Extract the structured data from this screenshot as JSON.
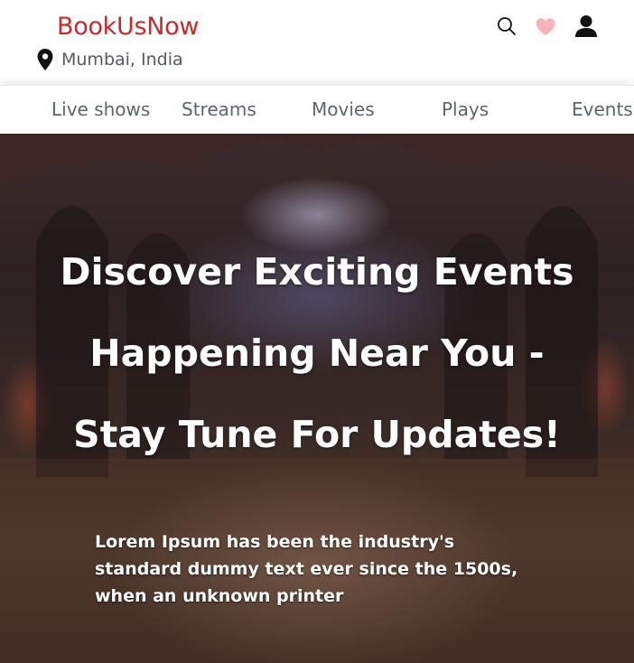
{
  "header": {
    "brand": "BookUsNow",
    "location": "Mumbai, India",
    "icons": [
      "search-icon",
      "heart-icon",
      "user-icon"
    ]
  },
  "nav": {
    "items": [
      "Live shows",
      "Streams",
      "Movies",
      "Plays",
      "Events"
    ]
  },
  "hero": {
    "title_lines": [
      "Discover Exciting Events",
      "Happening Near You -",
      "Stay Tune For Updates!"
    ],
    "description": "Lorem Ipsum has been the industry's standard dummy text ever since the 1500s, when an unknown printer"
  },
  "colors": {
    "brand": "#c62b2b",
    "heart": "#f7b3b8",
    "nav_text": "#5c646d",
    "location_text": "#555a60"
  }
}
